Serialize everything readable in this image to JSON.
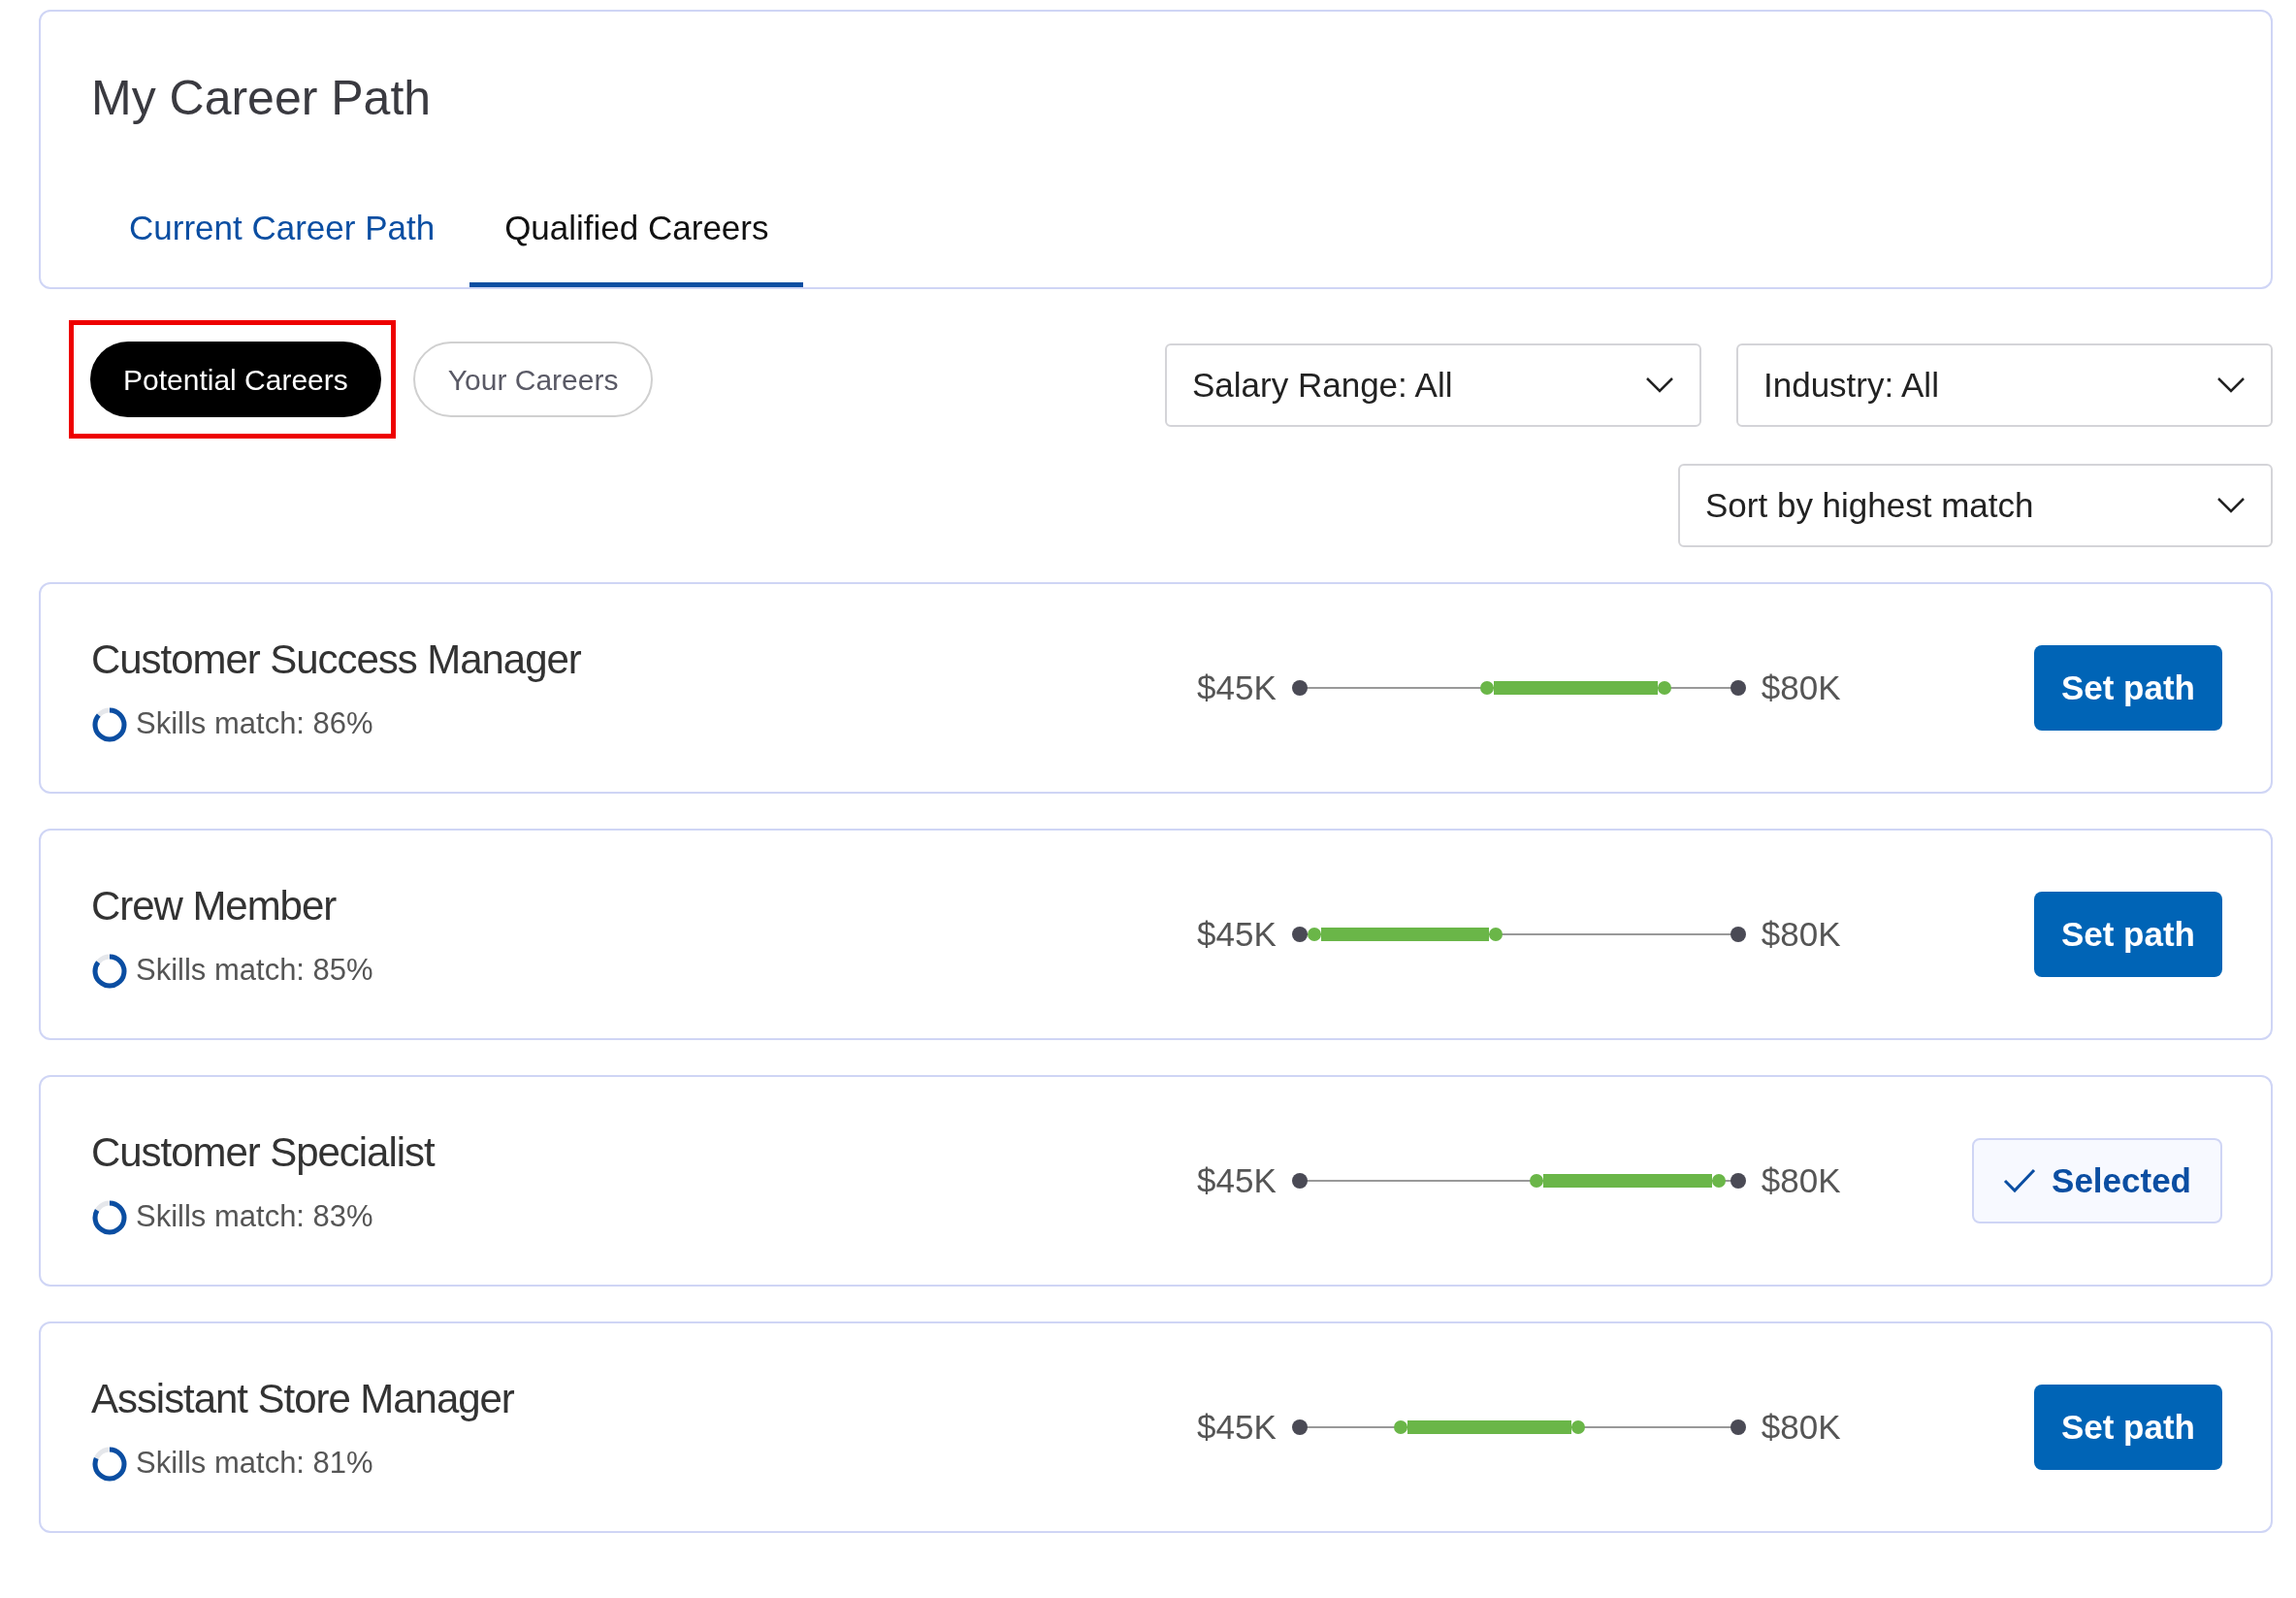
{
  "header": {
    "title": "My Career Path",
    "tabs": [
      {
        "label": "Current Career Path",
        "selected": false
      },
      {
        "label": "Qualified Careers",
        "selected": true
      }
    ]
  },
  "pills": [
    {
      "label": "Potential Careers",
      "selected": true,
      "highlighted": true
    },
    {
      "label": "Your Careers",
      "selected": false,
      "highlighted": false
    }
  ],
  "filters": [
    {
      "label": "Salary Range: All"
    },
    {
      "label": "Industry: All"
    }
  ],
  "sort": {
    "label": "Sort by highest match"
  },
  "careers": [
    {
      "title": "Customer Success Manager",
      "skills_match": "Skills match: 86%",
      "match_ring": {
        "level": 0.86
      },
      "min_salary": "$45K",
      "max_salary": "$80K",
      "range_low": {
        "level": 0.43
      },
      "range_high": {
        "level": 0.82
      },
      "action": {
        "label": "Set path",
        "selected": false
      }
    },
    {
      "title": "Crew Member",
      "skills_match": "Skills match: 85%",
      "match_ring": {
        "level": 0.85
      },
      "min_salary": "$45K",
      "max_salary": "$80K",
      "range_low": {
        "level": 0.05
      },
      "range_high": {
        "level": 0.45
      },
      "action": {
        "label": "Set path",
        "selected": false
      }
    },
    {
      "title": "Customer Specialist",
      "skills_match": "Skills match: 83%",
      "match_ring": {
        "level": 0.83
      },
      "min_salary": "$45K",
      "max_salary": "$80K",
      "range_low": {
        "level": 0.54
      },
      "range_high": {
        "level": 0.94
      },
      "action": {
        "label": "Selected",
        "selected": true
      }
    },
    {
      "title": "Assistant Store Manager",
      "skills_match": "Skills match: 81%",
      "match_ring": {
        "level": 0.81
      },
      "min_salary": "$45K",
      "max_salary": "$80K",
      "range_low": {
        "level": 0.24
      },
      "range_high": {
        "level": 0.63
      },
      "action": {
        "label": "Set path",
        "selected": false
      }
    }
  ]
}
